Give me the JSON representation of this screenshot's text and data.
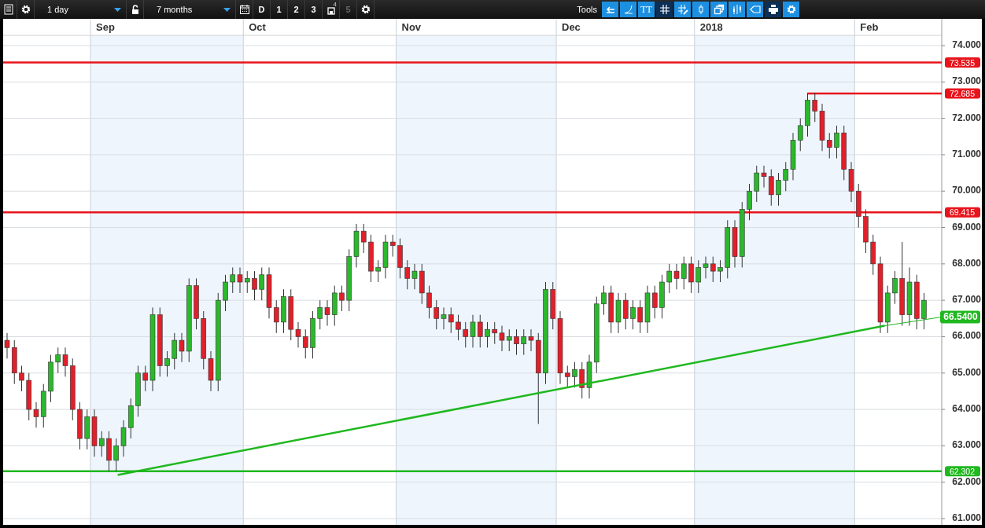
{
  "toolbar": {
    "left": [
      {
        "kind": "list"
      },
      {
        "kind": "settings"
      },
      {
        "kind": "dropdown",
        "value": "1 day"
      },
      {
        "kind": "lock"
      },
      {
        "kind": "dropdown",
        "value": "7 months"
      },
      {
        "kind": "calendar"
      },
      {
        "kind": "period",
        "label": "D",
        "disabled": false
      },
      {
        "kind": "period",
        "label": "1",
        "disabled": false
      },
      {
        "kind": "period",
        "label": "2",
        "disabled": false
      },
      {
        "kind": "period",
        "label": "3",
        "disabled": false
      },
      {
        "kind": "save",
        "badge": "4"
      },
      {
        "kind": "period",
        "label": "5",
        "disabled": true
      },
      {
        "kind": "settings"
      }
    ],
    "tools_label": "Tools",
    "tools": [
      {
        "kind": "back",
        "selected": false
      },
      {
        "kind": "curve",
        "selected": false
      },
      {
        "kind": "text",
        "label": "TT",
        "selected": false
      },
      {
        "kind": "grid",
        "selected": true
      },
      {
        "kind": "crosshair",
        "selected": false
      },
      {
        "kind": "candle",
        "selected": false
      },
      {
        "kind": "windows",
        "selected": false
      },
      {
        "kind": "candles",
        "selected": false
      },
      {
        "kind": "tag",
        "selected": false
      },
      {
        "kind": "print",
        "selected": true
      },
      {
        "kind": "config",
        "selected": false
      }
    ]
  },
  "chart": {
    "month_labels": [
      "Sep",
      "Oct",
      "Nov",
      "Dec",
      "2018",
      "Feb"
    ],
    "trend_line": {
      "label": "66.5400",
      "color": "#1fb81f"
    },
    "chart_data": {
      "type": "candlestick",
      "ylim": [
        61,
        74
      ],
      "grid": true,
      "ref_lines": [
        {
          "axis": "y",
          "value": 73.535,
          "label": "73.535",
          "color": "#e8141c"
        },
        {
          "axis": "y",
          "value": 72.685,
          "label": "72.685",
          "color": "#e8141c"
        },
        {
          "axis": "y",
          "value": 69.415,
          "label": "69.415",
          "color": "#e8141c"
        },
        {
          "axis": "y",
          "value": 62.302,
          "label": "62.302",
          "color": "#1fb81f"
        }
      ],
      "yticks": [
        {
          "value": 74,
          "label": "74.000"
        },
        {
          "value": 73,
          "label": "73.000"
        },
        {
          "value": 72,
          "label": "72.000"
        },
        {
          "value": 71,
          "label": "71.000"
        },
        {
          "value": 70,
          "label": "70.000"
        },
        {
          "value": 69,
          "label": "69.000"
        },
        {
          "value": 68,
          "label": "68.000"
        },
        {
          "value": 67,
          "label": "67.000"
        },
        {
          "value": 66,
          "label": "66.000"
        },
        {
          "value": 65,
          "label": "65.000"
        },
        {
          "value": 64,
          "label": "64.000"
        },
        {
          "value": 63,
          "label": "63.000"
        },
        {
          "value": 62,
          "label": "62.000"
        },
        {
          "value": 61,
          "label": "61.000"
        }
      ],
      "ohlc": [
        [
          65.9,
          66.1,
          65.4,
          65.7
        ],
        [
          65.7,
          65.9,
          64.7,
          65.0
        ],
        [
          65.0,
          65.2,
          64.5,
          64.8
        ],
        [
          64.8,
          65.0,
          63.7,
          64.0
        ],
        [
          64.0,
          64.2,
          63.5,
          63.8
        ],
        [
          63.8,
          64.7,
          63.5,
          64.5
        ],
        [
          64.5,
          65.5,
          64.2,
          65.3
        ],
        [
          65.3,
          65.7,
          65.0,
          65.5
        ],
        [
          65.5,
          65.7,
          64.9,
          65.2
        ],
        [
          65.2,
          65.4,
          63.7,
          64.0
        ],
        [
          64.0,
          64.2,
          62.9,
          63.2
        ],
        [
          63.2,
          64.0,
          62.9,
          63.8
        ],
        [
          63.8,
          64.0,
          62.7,
          63.0
        ],
        [
          63.0,
          63.4,
          62.7,
          63.2
        ],
        [
          63.2,
          63.4,
          62.3,
          62.6
        ],
        [
          62.6,
          63.2,
          62.3,
          63.0
        ],
        [
          63.0,
          63.7,
          62.7,
          63.5
        ],
        [
          63.5,
          64.3,
          63.2,
          64.1
        ],
        [
          64.1,
          65.2,
          63.8,
          65.0
        ],
        [
          65.0,
          65.2,
          64.5,
          64.8
        ],
        [
          64.8,
          66.8,
          64.5,
          66.6
        ],
        [
          66.6,
          66.8,
          64.9,
          65.2
        ],
        [
          65.2,
          65.6,
          64.9,
          65.4
        ],
        [
          65.4,
          66.1,
          65.1,
          65.9
        ],
        [
          65.9,
          66.1,
          65.3,
          65.6
        ],
        [
          65.6,
          67.6,
          65.3,
          67.4
        ],
        [
          67.4,
          67.6,
          66.2,
          66.5
        ],
        [
          66.5,
          66.7,
          65.1,
          65.4
        ],
        [
          65.4,
          65.6,
          64.5,
          64.8
        ],
        [
          64.8,
          67.2,
          64.5,
          67.0
        ],
        [
          67.0,
          67.7,
          66.7,
          67.5
        ],
        [
          67.5,
          67.9,
          67.2,
          67.7
        ],
        [
          67.7,
          67.9,
          67.2,
          67.5
        ],
        [
          67.5,
          67.8,
          67.2,
          67.6
        ],
        [
          67.6,
          67.8,
          67.0,
          67.3
        ],
        [
          67.3,
          67.9,
          67.0,
          67.7
        ],
        [
          67.7,
          67.9,
          66.5,
          66.8
        ],
        [
          66.8,
          67.0,
          66.1,
          66.4
        ],
        [
          66.4,
          67.3,
          66.1,
          67.1
        ],
        [
          67.1,
          67.3,
          65.9,
          66.2
        ],
        [
          66.2,
          66.4,
          65.7,
          66.0
        ],
        [
          66.0,
          66.2,
          65.4,
          65.7
        ],
        [
          65.7,
          66.7,
          65.4,
          66.5
        ],
        [
          66.5,
          67.0,
          66.2,
          66.8
        ],
        [
          66.8,
          67.0,
          66.3,
          66.6
        ],
        [
          66.6,
          67.4,
          66.3,
          67.2
        ],
        [
          67.2,
          67.4,
          66.7,
          67.0
        ],
        [
          67.0,
          68.4,
          66.7,
          68.2
        ],
        [
          68.2,
          69.1,
          67.9,
          68.9
        ],
        [
          68.9,
          69.1,
          68.3,
          68.6
        ],
        [
          68.6,
          68.8,
          67.5,
          67.8
        ],
        [
          67.8,
          68.1,
          67.5,
          67.9
        ],
        [
          67.9,
          68.8,
          67.6,
          68.6
        ],
        [
          68.6,
          68.8,
          68.2,
          68.5
        ],
        [
          68.5,
          68.7,
          67.6,
          67.9
        ],
        [
          67.9,
          68.1,
          67.3,
          67.6
        ],
        [
          67.6,
          68.0,
          67.3,
          67.8
        ],
        [
          67.8,
          68.0,
          66.9,
          67.2
        ],
        [
          67.2,
          67.4,
          66.5,
          66.8
        ],
        [
          66.8,
          67.0,
          66.2,
          66.5
        ],
        [
          66.5,
          66.8,
          66.2,
          66.6
        ],
        [
          66.6,
          66.8,
          66.1,
          66.4
        ],
        [
          66.4,
          66.6,
          65.9,
          66.2
        ],
        [
          66.2,
          66.4,
          65.7,
          66.0
        ],
        [
          66.0,
          66.6,
          65.7,
          66.4
        ],
        [
          66.4,
          66.6,
          65.7,
          66.0
        ],
        [
          66.0,
          66.4,
          65.7,
          66.2
        ],
        [
          66.2,
          66.4,
          65.8,
          66.1
        ],
        [
          66.1,
          66.3,
          65.6,
          65.9
        ],
        [
          65.9,
          66.2,
          65.6,
          66.0
        ],
        [
          66.0,
          66.2,
          65.5,
          65.8
        ],
        [
          65.8,
          66.2,
          65.5,
          66.0
        ],
        [
          66.0,
          66.2,
          65.6,
          65.9
        ],
        [
          65.9,
          66.1,
          63.6,
          65.0
        ],
        [
          65.0,
          67.5,
          64.7,
          67.3
        ],
        [
          67.3,
          67.5,
          66.2,
          66.5
        ],
        [
          66.5,
          66.7,
          64.7,
          65.0
        ],
        [
          65.0,
          65.2,
          64.6,
          64.9
        ],
        [
          64.9,
          65.3,
          64.6,
          65.1
        ],
        [
          65.1,
          65.3,
          64.3,
          64.6
        ],
        [
          64.6,
          65.5,
          64.3,
          65.3
        ],
        [
          65.3,
          67.1,
          65.0,
          66.9
        ],
        [
          66.9,
          67.4,
          66.6,
          67.2
        ],
        [
          67.2,
          67.4,
          66.1,
          66.4
        ],
        [
          66.4,
          67.2,
          66.1,
          67.0
        ],
        [
          67.0,
          67.2,
          66.2,
          66.5
        ],
        [
          66.5,
          67.0,
          66.2,
          66.8
        ],
        [
          66.8,
          67.0,
          66.1,
          66.4
        ],
        [
          66.4,
          67.4,
          66.1,
          67.2
        ],
        [
          67.2,
          67.4,
          66.5,
          66.8
        ],
        [
          66.8,
          67.7,
          66.5,
          67.5
        ],
        [
          67.5,
          68.0,
          67.2,
          67.8
        ],
        [
          67.8,
          68.0,
          67.3,
          67.6
        ],
        [
          67.6,
          68.2,
          67.3,
          68.0
        ],
        [
          68.0,
          68.2,
          67.2,
          67.5
        ],
        [
          67.5,
          68.1,
          67.2,
          67.9
        ],
        [
          67.9,
          68.2,
          67.6,
          68.0
        ],
        [
          68.0,
          68.2,
          67.5,
          67.8
        ],
        [
          67.8,
          68.1,
          67.5,
          67.9
        ],
        [
          67.9,
          69.2,
          67.6,
          69.0
        ],
        [
          69.0,
          69.2,
          67.9,
          68.2
        ],
        [
          68.2,
          69.7,
          67.9,
          69.5
        ],
        [
          69.5,
          70.2,
          69.2,
          70.0
        ],
        [
          70.0,
          70.7,
          69.7,
          70.5
        ],
        [
          70.5,
          70.7,
          70.1,
          70.4
        ],
        [
          70.4,
          70.6,
          69.6,
          69.9
        ],
        [
          69.9,
          70.5,
          69.6,
          70.3
        ],
        [
          70.3,
          70.8,
          70.0,
          70.6
        ],
        [
          70.6,
          71.6,
          70.3,
          71.4
        ],
        [
          71.4,
          72.0,
          71.1,
          71.8
        ],
        [
          71.8,
          72.7,
          71.5,
          72.5
        ],
        [
          72.5,
          72.7,
          71.9,
          72.2
        ],
        [
          72.2,
          72.4,
          71.1,
          71.4
        ],
        [
          71.4,
          71.6,
          70.9,
          71.2
        ],
        [
          71.2,
          71.8,
          70.9,
          71.6
        ],
        [
          71.6,
          71.8,
          70.3,
          70.6
        ],
        [
          70.6,
          70.8,
          69.7,
          70.0
        ],
        [
          70.0,
          70.2,
          69.0,
          69.3
        ],
        [
          69.3,
          69.5,
          68.3,
          68.6
        ],
        [
          68.6,
          68.8,
          67.7,
          68.0
        ],
        [
          68.0,
          68.2,
          66.1,
          66.4
        ],
        [
          66.4,
          67.4,
          66.1,
          67.2
        ],
        [
          67.2,
          67.8,
          66.9,
          67.6
        ],
        [
          67.6,
          68.6,
          66.3,
          66.6
        ],
        [
          66.6,
          67.9,
          66.3,
          67.5
        ],
        [
          67.5,
          67.7,
          66.2,
          66.5
        ],
        [
          66.5,
          67.2,
          66.2,
          67.0
        ]
      ]
    }
  }
}
